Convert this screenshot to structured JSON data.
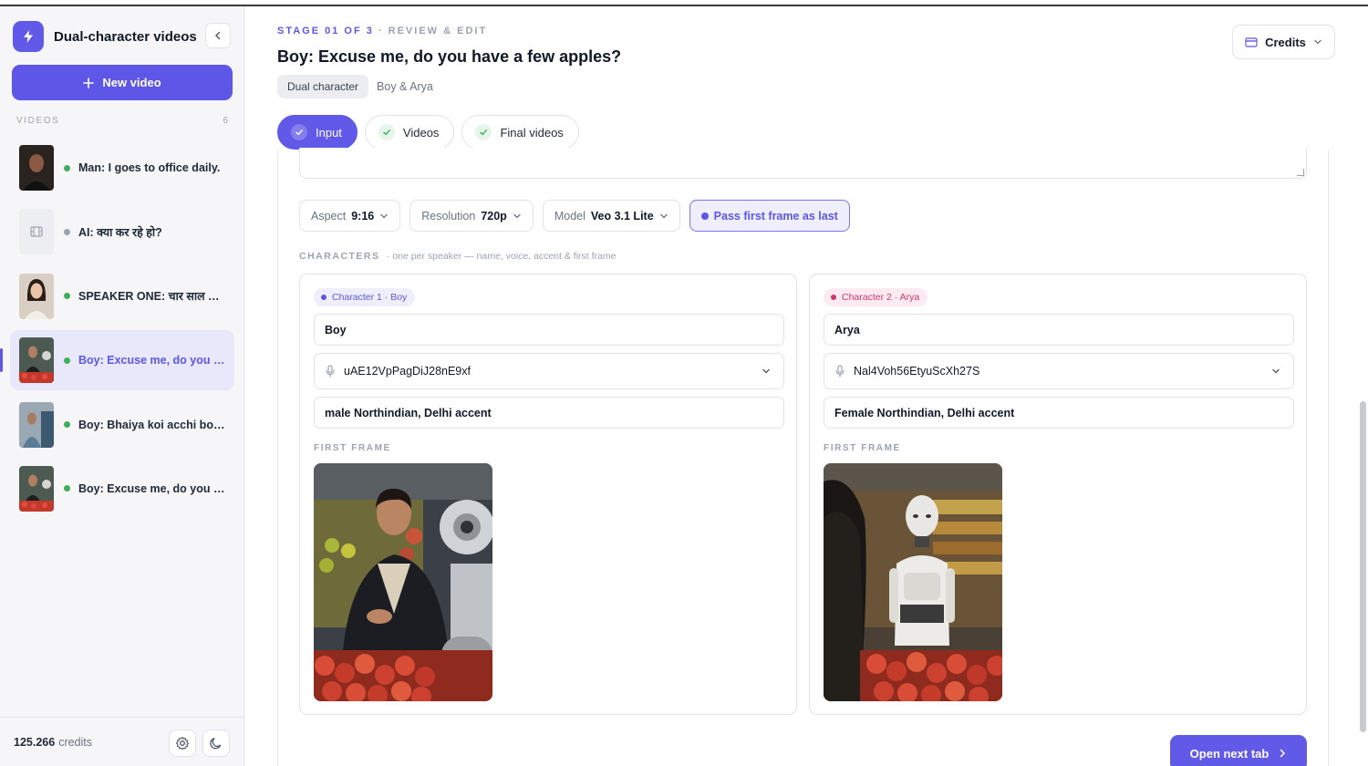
{
  "sidebar": {
    "title": "Dual-character videos",
    "new_video_label": "New video",
    "videos_heading": "VIDEOS",
    "videos_count": "6",
    "items": [
      {
        "label": "Man: I goes to office daily.",
        "status_color": "#3fae5a"
      },
      {
        "label": "AI: क्या कर रहे हो?",
        "status_color": "#9ca3af"
      },
      {
        "label": "SPEAKER ONE: चार साल हो ...",
        "status_color": "#3fae5a"
      },
      {
        "label": "Boy: Excuse me, do you h...",
        "status_color": "#3fae5a"
      },
      {
        "label": "Boy: Bhaiya koi acchi boo...",
        "status_color": "#3fae5a"
      },
      {
        "label": "Boy: Excuse me, do you h...",
        "status_color": "#3fae5a"
      }
    ],
    "credits_amount": "125.266",
    "credits_label": "credits"
  },
  "header": {
    "stage": "STAGE 01 OF 3",
    "stage_sep": " · ",
    "stage_desc": "REVIEW & EDIT",
    "title": "Boy: Excuse me, do you have a few apples?",
    "type_pill": "Dual character",
    "characters_text": "Boy & Arya",
    "credits_button": "Credits"
  },
  "tabs": [
    {
      "label": "Input",
      "active": true
    },
    {
      "label": "Videos",
      "active": false
    },
    {
      "label": "Final videos",
      "active": false
    }
  ],
  "options": {
    "aspect_key": "Aspect",
    "aspect_value": "9:16",
    "resolution_key": "Resolution",
    "resolution_value": "720p",
    "model_key": "Model",
    "model_value": "Veo 3.1 Lite",
    "pass_frame_label": "Pass first frame as last"
  },
  "characters": {
    "heading": "CHARACTERS",
    "subheading": "· one per speaker — name, voice, accent & first frame",
    "first_frame_label": "FIRST FRAME",
    "list": [
      {
        "tag": "Character 1 · Boy",
        "accent": "#5d56e6",
        "name": "Boy",
        "voice_id": "uAE12VpPagDiJ28nE9xf",
        "accent_desc": "male Northindian, Delhi accent"
      },
      {
        "tag": "Character 2 · Arya",
        "accent": "#d6336c",
        "name": "Arya",
        "voice_id": "Nal4Voh56EtyuScXh27S",
        "accent_desc": "Female Northindian, Delhi accent"
      }
    ]
  },
  "footer": {
    "next_label": "Open next tab"
  },
  "colors": {
    "brand": "#5d56e6",
    "success": "#3fae5a",
    "pink": "#d6336c"
  }
}
